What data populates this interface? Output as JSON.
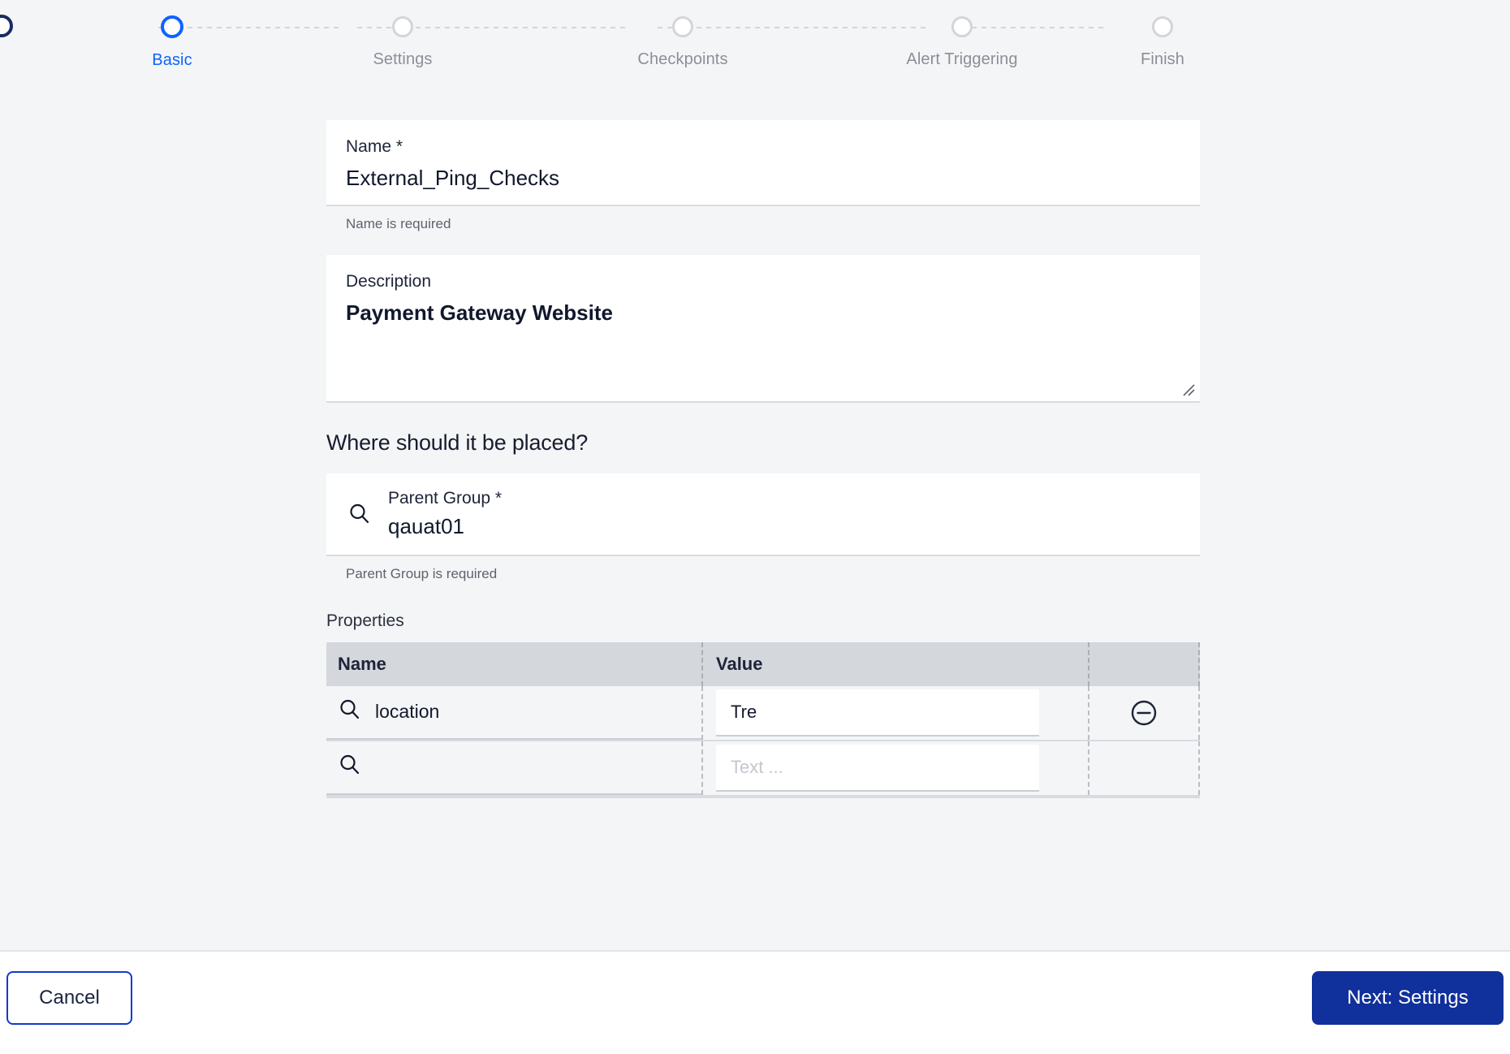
{
  "stepper": {
    "steps": [
      {
        "label": "Basic",
        "state": "active"
      },
      {
        "label": "Settings",
        "state": "inactive"
      },
      {
        "label": "Checkpoints",
        "state": "inactive"
      },
      {
        "label": "Alert Triggering",
        "state": "inactive"
      },
      {
        "label": "Finish",
        "state": "inactive"
      }
    ],
    "active_color": "#0f62fe",
    "inactive_color": "#8a8f98"
  },
  "form": {
    "name_field": {
      "label": "Name *",
      "value": "External_Ping_Checks",
      "helper": "Name is required"
    },
    "description_field": {
      "label": "Description",
      "value": "Payment Gateway Website"
    },
    "placement": {
      "section_title": "Where should it be placed?",
      "parent_group": {
        "label": "Parent Group *",
        "value": "qauat01",
        "helper": "Parent Group is required",
        "icon": "search-icon"
      }
    },
    "properties": {
      "title": "Properties",
      "columns": [
        "Name",
        "Value"
      ],
      "rows": [
        {
          "name": "location",
          "value": "Tre",
          "value_placeholder": "Text ...",
          "remove_icon": "minus-circle-icon"
        },
        {
          "name": "",
          "value": "",
          "value_placeholder": "Text ...",
          "remove_icon": ""
        }
      ]
    }
  },
  "footer": {
    "cancel_label": "Cancel",
    "next_label": "Next: Settings",
    "cancel_border_color": "#1139d2",
    "next_bg_color": "#10309b"
  }
}
